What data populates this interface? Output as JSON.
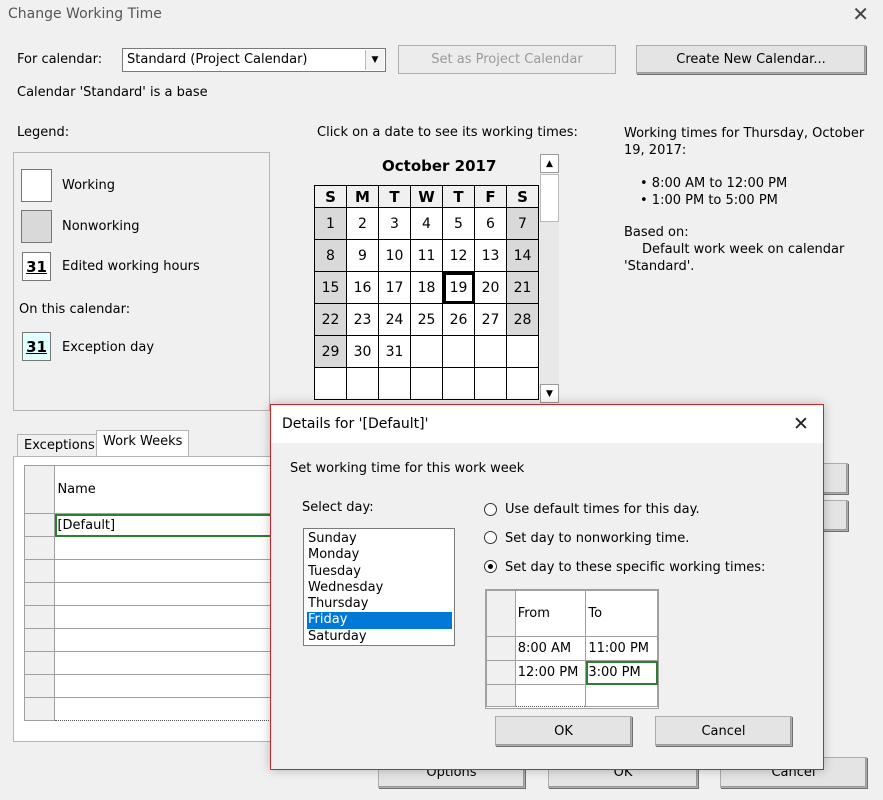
{
  "window": {
    "title": "Change Working Time"
  },
  "top": {
    "for_calendar_label": "For calendar:",
    "calendar_value": "Standard (Project Calendar)",
    "set_project_button": "Set as Project Calendar",
    "create_new_button": "Create New Calendar...",
    "base_note": "Calendar 'Standard' is a base"
  },
  "legend": {
    "heading": "Legend:",
    "working": "Working",
    "nonworking": "Nonworking",
    "edited_num": "31",
    "edited": "Edited working hours",
    "on_this_calendar": "On this calendar:",
    "exception_num": "31",
    "exception": "Exception day"
  },
  "calendar": {
    "instruction": "Click on a date to see its working times:",
    "month": "October 2017",
    "day_headers": [
      "S",
      "M",
      "T",
      "W",
      "T",
      "F",
      "S"
    ],
    "weeks": [
      [
        "1",
        "2",
        "3",
        "4",
        "5",
        "6",
        "7"
      ],
      [
        "8",
        "9",
        "10",
        "11",
        "12",
        "13",
        "14"
      ],
      [
        "15",
        "16",
        "17",
        "18",
        "19",
        "20",
        "21"
      ],
      [
        "22",
        "23",
        "24",
        "25",
        "26",
        "27",
        "28"
      ],
      [
        "29",
        "30",
        "31",
        "",
        "",
        "",
        ""
      ],
      [
        "",
        "",
        "",
        "",
        "",
        "",
        ""
      ]
    ],
    "selected_day": "19"
  },
  "info": {
    "heading": "Working times for Thursday, October 19, 2017:",
    "times": [
      "• 8:00 AM to 12:00 PM",
      "• 1:00 PM to 5:00 PM"
    ],
    "based_on": "Based on:",
    "based_detail": "Default work week on calendar 'Standard'."
  },
  "tabs": {
    "exceptions": "Exceptions",
    "work_weeks": "Work Weeks"
  },
  "work_weeks": {
    "name_header": "Name",
    "rows": [
      "[Default]",
      "",
      "",
      "",
      "",
      "",
      "",
      "",
      ""
    ]
  },
  "bottom": {
    "options": "Options",
    "ok": "OK",
    "cancel": "Cancel"
  },
  "dialog": {
    "title": "Details for '[Default]'",
    "subtitle": "Set working time for this work week",
    "select_day_label": "Select day:",
    "days": [
      "Sunday",
      "Monday",
      "Tuesday",
      "Wednesday",
      "Thursday",
      "Friday",
      "Saturday"
    ],
    "selected_day": "Friday",
    "radio_default": "Use default times for this day.",
    "radio_nonworking": "Set day to nonworking time.",
    "radio_specific": "Set day to these specific working times:",
    "from_header": "From",
    "to_header": "To",
    "times": [
      {
        "from": "8:00 AM",
        "to": "11:00 PM"
      },
      {
        "from": "12:00 PM",
        "to": "3:00 PM"
      },
      {
        "from": "",
        "to": ""
      }
    ],
    "ok": "OK",
    "cancel": "Cancel"
  }
}
